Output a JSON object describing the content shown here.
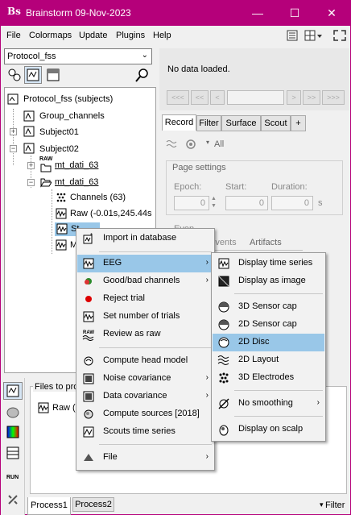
{
  "window": {
    "title": "Brainstorm 09-Nov-2023",
    "controls": [
      "—",
      "☐",
      "✕"
    ]
  },
  "menubar": {
    "items": [
      "File",
      "Colormaps",
      "Update",
      "Plugins",
      "Help"
    ]
  },
  "protocol": {
    "selected": "Protocol_fss"
  },
  "tree": {
    "root": "Protocol_fss (subjects)",
    "group_channels": "Group_channels",
    "subject01": "Subject01",
    "subject02": "Subject02",
    "raw_label": "RAW",
    "raw_folder": "mt_dati_63",
    "folder": "mt_dati_63",
    "channels": "Channels (63)",
    "raw_file": "Raw (-0.01s,245.44s",
    "std_partial": "St",
    "m_partial": "M"
  },
  "right_panel": {
    "no_data": "No data loaded.",
    "nav": [
      "<<<",
      "<<",
      "<",
      ">",
      ">>>",
      ">>"
    ],
    "tabs": [
      "Record",
      "Filter",
      "Surface",
      "Scout",
      "+"
    ],
    "all_label": "All",
    "page_settings": "Page settings",
    "epoch_label": "Epoch:",
    "start_label": "Start:",
    "duration_label": "Duration:",
    "epoch_value": "0",
    "start_value": "0",
    "duration_value": "0",
    "s_unit": "s",
    "events_label": "Events",
    "artifacts_label": "Artifacts",
    "events_partial": "Even"
  },
  "bottom": {
    "files_label": "Files to pro",
    "raw_item": "Raw (",
    "tabs": [
      "Process1",
      "Process2"
    ],
    "filter": "Filter",
    "run_label": "RUN"
  },
  "context_menu": {
    "items": [
      {
        "label": "Import in database",
        "icon": "import-icon"
      },
      {
        "label": "EEG",
        "icon": "eeg-icon",
        "submenu": true
      },
      {
        "label": "Good/bad channels",
        "icon": "good-bad-channels-icon",
        "submenu": true
      },
      {
        "label": "Reject trial",
        "icon": "reject-trial-icon"
      },
      {
        "label": "Set number of trials",
        "icon": "trials-icon"
      },
      {
        "label": "Review as raw",
        "icon": "raw-icon"
      },
      {
        "label": "Compute head model",
        "icon": "head-model-icon"
      },
      {
        "label": "Noise covariance",
        "icon": "noise-covariance-icon",
        "submenu": true
      },
      {
        "label": "Data covariance",
        "icon": "data-covariance-icon",
        "submenu": true
      },
      {
        "label": "Compute sources [2018]",
        "icon": "sources-icon"
      },
      {
        "label": "Scouts time series",
        "icon": "scouts-icon"
      },
      {
        "label": "File",
        "icon": "file-icon",
        "submenu": true
      }
    ]
  },
  "eeg_submenu": {
    "items": [
      {
        "label": "Display time series",
        "icon": "time-series-icon"
      },
      {
        "label": "Display as image",
        "icon": "image-icon"
      },
      {
        "label": "3D Sensor cap",
        "icon": "sensor-cap-3d-icon"
      },
      {
        "label": "2D Sensor cap",
        "icon": "sensor-cap-2d-icon"
      },
      {
        "label": "2D Disc",
        "icon": "disc-2d-icon"
      },
      {
        "label": "2D Layout",
        "icon": "layout-2d-icon"
      },
      {
        "label": "3D Electrodes",
        "icon": "electrodes-3d-icon"
      },
      {
        "label": "No smoothing",
        "icon": "no-smoothing-icon",
        "submenu": true
      },
      {
        "label": "Display on scalp",
        "icon": "scalp-icon"
      }
    ]
  },
  "colors": {
    "titlebar": "#b5007a",
    "highlight": "#99c7e8"
  }
}
